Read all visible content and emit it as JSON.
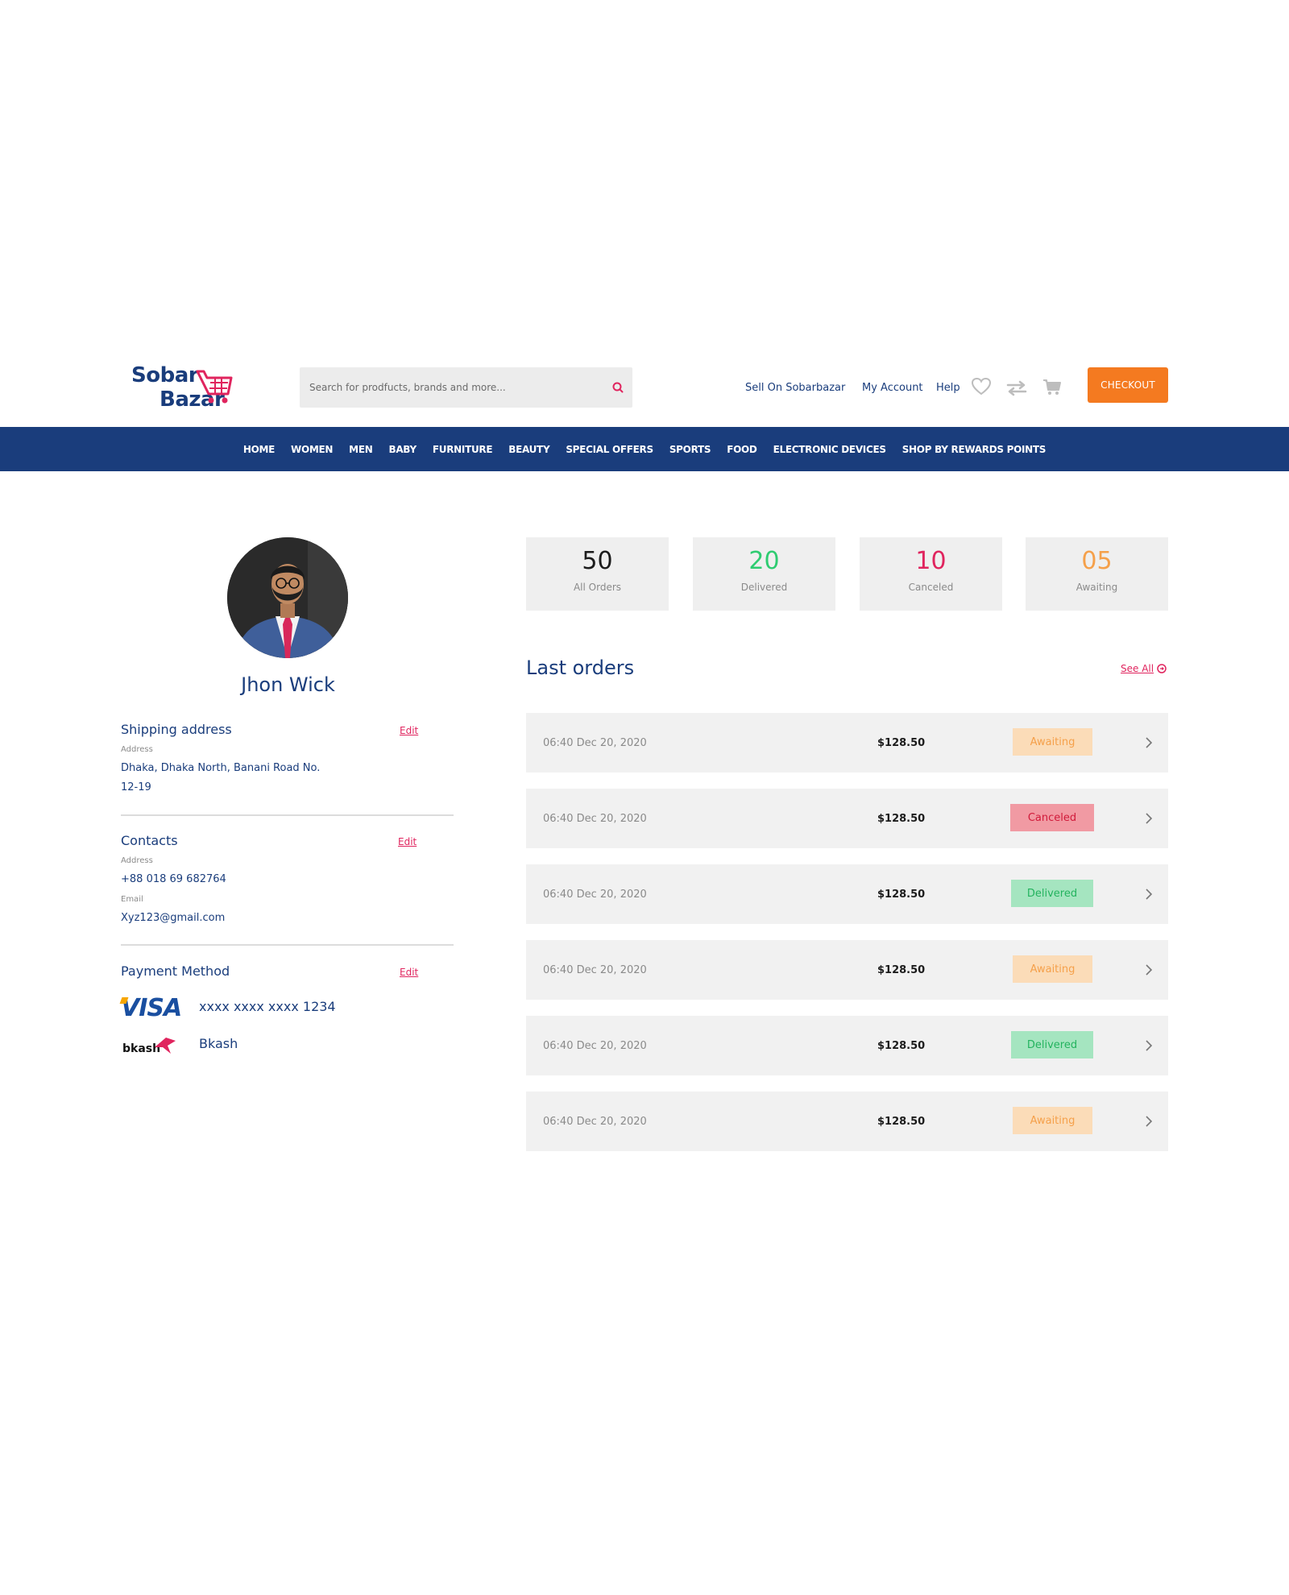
{
  "brand": {
    "line1": "Sobar",
    "line2": "Bazar",
    "color": "#1a3d7c",
    "accent": "#e0245e"
  },
  "search": {
    "placeholder": "Search for prodfucts, brands and more..."
  },
  "header_links": {
    "sell": "Sell On Sobarbazar",
    "account": "My Account",
    "help": "Help"
  },
  "header_icons": [
    "heart-icon",
    "compare-arrows-icon",
    "cart-icon"
  ],
  "checkout_label": "CHECKOUT",
  "nav": [
    "HOME",
    "WOMEN",
    "MEN",
    "BABY",
    "FURNITURE",
    "BEAUTY",
    "SPECIAL OFFERS",
    "SPORTS",
    "FOOD",
    "ELECTRONIC DEVICES",
    "SHOP BY REWARDS POINTS"
  ],
  "profile": {
    "name": "Jhon Wick",
    "shipping": {
      "title": "Shipping address",
      "edit": "Edit",
      "address_label": "Address",
      "address_line1": "Dhaka, Dhaka North, Banani Road No.",
      "address_line2": "12-19"
    },
    "contacts": {
      "title": "Contacts",
      "edit": "Edit",
      "address_label": "Address",
      "phone": "+88 018 69 682764",
      "email_label": "Email",
      "email": "Xyz123@gmail.com"
    },
    "payment": {
      "title": "Payment Method",
      "edit": "Edit",
      "card_brand": "VISA",
      "card_number": "xxxx xxxx xxxx 1234",
      "wallet_brand": "bkash",
      "wallet_name": "Bkash"
    }
  },
  "stats": [
    {
      "value": "50",
      "label": "All Orders",
      "color": "#1c1c1c"
    },
    {
      "value": "20",
      "label": "Delivered",
      "color": "#2ecc71"
    },
    {
      "value": "10",
      "label": "Canceled",
      "color": "#e0245e"
    },
    {
      "value": "05",
      "label": "Awaiting",
      "color": "#f5a04a"
    }
  ],
  "orders_section": {
    "title": "Last orders",
    "see_all": "See All"
  },
  "orders": [
    {
      "date": "06:40 Dec 20, 2020",
      "price": "$128.50",
      "status": "Awaiting"
    },
    {
      "date": "06:40 Dec 20, 2020",
      "price": "$128.50",
      "status": "Canceled"
    },
    {
      "date": "06:40 Dec 20, 2020",
      "price": "$128.50",
      "status": "Delivered"
    },
    {
      "date": "06:40 Dec 20, 2020",
      "price": "$128.50",
      "status": "Awaiting"
    },
    {
      "date": "06:40 Dec 20, 2020",
      "price": "$128.50",
      "status": "Delivered"
    },
    {
      "date": "06:40 Dec 20, 2020",
      "price": "$128.50",
      "status": "Awaiting"
    }
  ],
  "status_colors": {
    "Awaiting": {
      "bg": "#fbdcb8",
      "fg": "#f5a04a"
    },
    "Canceled": {
      "bg": "#f19aa3",
      "fg": "#d11a3a"
    },
    "Delivered": {
      "bg": "#a5e5c0",
      "fg": "#23b35e"
    }
  },
  "colors": {
    "nav_bg": "#1a3d7c",
    "checkout": "#f47a20",
    "edit": "#e0245e"
  }
}
